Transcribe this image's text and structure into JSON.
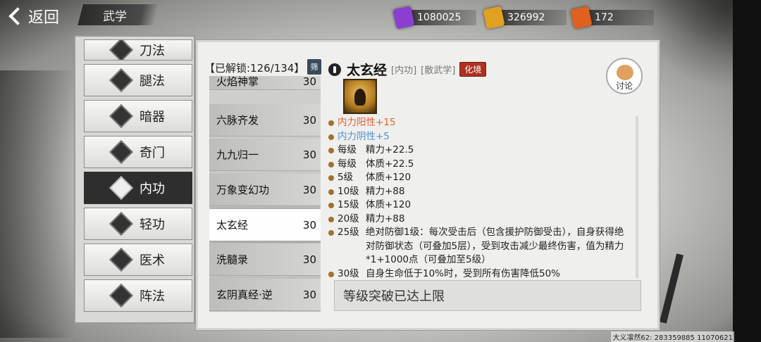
{
  "header": {
    "back_label": "返回",
    "page_title": "武学"
  },
  "currencies": [
    {
      "icon": "purple-scroll-icon",
      "color": "#8a3fd0",
      "value": "1080025"
    },
    {
      "icon": "gold-scroll-icon",
      "color": "#e0a020",
      "value": "326992"
    },
    {
      "icon": "orange-scroll-icon",
      "color": "#e06020",
      "value": "172"
    }
  ],
  "categories": [
    {
      "label": "刀法",
      "icon": "blade-icon",
      "active": false
    },
    {
      "label": "腿法",
      "icon": "kick-icon",
      "active": false
    },
    {
      "label": "暗器",
      "icon": "hidden-weapon-icon",
      "active": false
    },
    {
      "label": "奇门",
      "icon": "exotic-weapon-icon",
      "active": false
    },
    {
      "label": "内功",
      "icon": "inner-power-icon",
      "active": true
    },
    {
      "label": "轻功",
      "icon": "lightness-icon",
      "active": false
    },
    {
      "label": "医术",
      "icon": "medicine-icon",
      "active": false
    },
    {
      "label": "阵法",
      "icon": "formation-icon",
      "active": false
    }
  ],
  "list": {
    "unlock_text": "【已解锁:126/134】",
    "filter_label": "筛",
    "skills": [
      {
        "name": "火焰神掌",
        "level": "30"
      },
      {
        "name": "六脉齐发",
        "level": "30"
      },
      {
        "name": "九九归一",
        "level": "30"
      },
      {
        "name": "万象变幻功",
        "level": "30"
      },
      {
        "name": "太玄经",
        "level": "30",
        "active": true
      },
      {
        "name": "洗髓录",
        "level": "30"
      },
      {
        "name": "玄阴真经·逆",
        "level": "30"
      }
    ]
  },
  "detail": {
    "name": "太玄经",
    "type_tag": "[内功]",
    "school_tag": "[散武学]",
    "realm_badge": "化境",
    "discuss_label": "讨论",
    "effects": [
      {
        "level": "",
        "text": "内力阳性+15",
        "kind": "yang"
      },
      {
        "level": "",
        "text": "内力阴性+5",
        "kind": "yin"
      },
      {
        "level": "每级",
        "text": "精力+22.5"
      },
      {
        "level": "每级",
        "text": "体质+22.5"
      },
      {
        "level": "5级",
        "text": "体质+120"
      },
      {
        "level": "10级",
        "text": "精力+88"
      },
      {
        "level": "15级",
        "text": "体质+120"
      },
      {
        "level": "20级",
        "text": "精力+88"
      },
      {
        "level": "25级",
        "text": "绝对防御1级：每次受击后（包含援护防御受击），自身获得绝对防御状态（可叠加5层），受到攻击减少最终伤害，值为精力*1+1000点（可叠加至5级）"
      },
      {
        "level": "30级",
        "text": "自身生命低于10%时，受到所有伤害降低50%"
      }
    ],
    "breakthrough_text": "等级突破已达上限"
  },
  "footer": {
    "id_text": "大义凛然62: 283359885  11070621"
  }
}
